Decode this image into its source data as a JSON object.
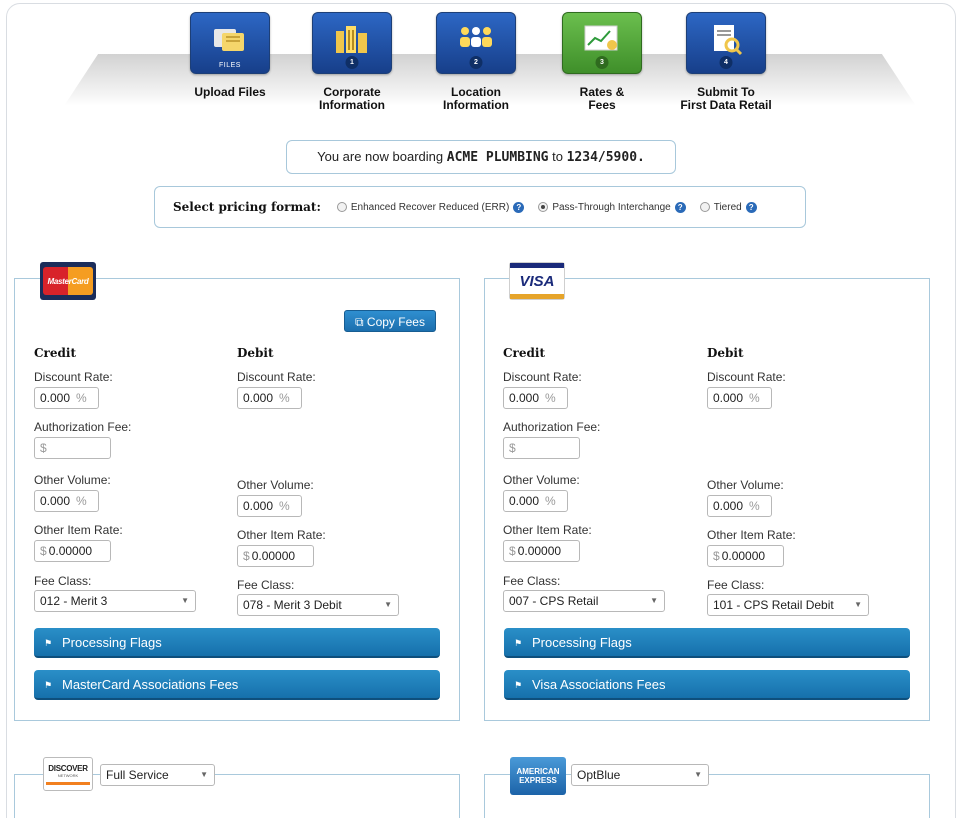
{
  "wizard": {
    "steps": [
      {
        "label_line1": "Upload Files",
        "label_line2": "",
        "tag": "FILES",
        "icon": "files-icon"
      },
      {
        "label_line1": "Corporate",
        "label_line2": "Information",
        "tag": "1",
        "icon": "building-icon"
      },
      {
        "label_line1": "Location",
        "label_line2": "Information",
        "tag": "2",
        "icon": "people-icon"
      },
      {
        "label_line1": "Rates &",
        "label_line2": "Fees",
        "tag": "3",
        "icon": "chart-icon"
      },
      {
        "label_line1": "Submit To",
        "label_line2": "First Data Retail",
        "tag": "4",
        "icon": "document-search-icon"
      }
    ],
    "active_step": 3,
    "active_color": "#5aae3e",
    "inactive_color": "#2358b0"
  },
  "boarding": {
    "prefix": "You are now boarding",
    "merchant": "ACME PLUMBING",
    "mid": "to",
    "number": "1234/5900."
  },
  "pricing": {
    "label": "Select pricing format:",
    "options": [
      {
        "label": "Enhanced Recover Reduced (ERR)",
        "checked": false
      },
      {
        "label": "Pass-Through Interchange",
        "checked": true
      },
      {
        "label": "Tiered",
        "checked": false
      }
    ]
  },
  "mastercard": {
    "logo_text": "MasterCard",
    "copy_button": "Copy Fees",
    "credit": {
      "heading": "Credit",
      "discount_label": "Discount Rate:",
      "discount_value": "0.000",
      "discount_unit": "%",
      "auth_label": "Authorization Fee:",
      "auth_currency": "$",
      "auth_value": "",
      "other_volume_label": "Other Volume:",
      "other_volume_value": "0.000",
      "other_volume_unit": "%",
      "other_item_label": "Other Item Rate:",
      "other_item_currency": "$",
      "other_item_value": "0.00000",
      "fee_class_label": "Fee Class:",
      "fee_class_value": "012 - Merit 3"
    },
    "debit": {
      "heading": "Debit",
      "discount_label": "Discount Rate:",
      "discount_value": "0.000",
      "discount_unit": "%",
      "other_volume_label": "Other Volume:",
      "other_volume_value": "0.000",
      "other_volume_unit": "%",
      "other_item_label": "Other Item Rate:",
      "other_item_currency": "$",
      "other_item_value": "0.00000",
      "fee_class_label": "Fee Class:",
      "fee_class_value": "078 - Merit 3 Debit"
    },
    "processing_flags": "Processing Flags",
    "association_fees": "MasterCard Associations Fees"
  },
  "visa": {
    "logo_text": "VISA",
    "credit": {
      "heading": "Credit",
      "discount_label": "Discount Rate:",
      "discount_value": "0.000",
      "discount_unit": "%",
      "auth_label": "Authorization Fee:",
      "auth_currency": "$",
      "auth_value": "",
      "other_volume_label": "Other Volume:",
      "other_volume_value": "0.000",
      "other_volume_unit": "%",
      "other_item_label": "Other Item Rate:",
      "other_item_currency": "$",
      "other_item_value": "0.00000",
      "fee_class_label": "Fee Class:",
      "fee_class_value": "007 - CPS Retail"
    },
    "debit": {
      "heading": "Debit",
      "discount_label": "Discount Rate:",
      "discount_value": "0.000",
      "discount_unit": "%",
      "other_volume_label": "Other Volume:",
      "other_volume_value": "0.000",
      "other_volume_unit": "%",
      "other_item_label": "Other Item Rate:",
      "other_item_currency": "$",
      "other_item_value": "0.00000",
      "fee_class_label": "Fee Class:",
      "fee_class_value": "101 - CPS Retail Debit"
    },
    "processing_flags": "Processing Flags",
    "association_fees": "Visa Associations Fees"
  },
  "discover": {
    "logo_line1": "DISCOVER",
    "logo_line2": "NETWORK",
    "service_value": "Full Service"
  },
  "amex": {
    "logo_line1": "AMERICAN",
    "logo_line2": "EXPRESS",
    "service_value": "OptBlue"
  },
  "colors": {
    "accent_blue": "#1c78b8",
    "border_blue": "#a9c9dc"
  }
}
